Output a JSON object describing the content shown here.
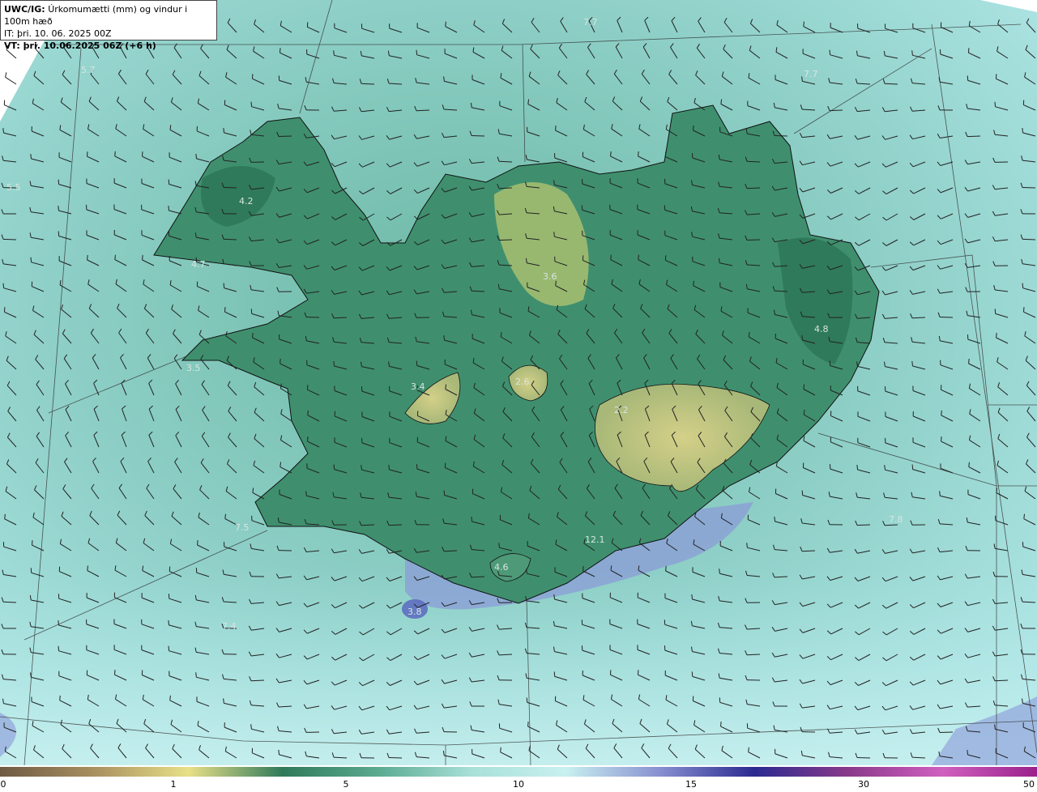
{
  "header": {
    "model": "UWC/IG:",
    "title": "Úrkomumætti (mm) og vindur i 100m hæð",
    "initial_time": "IT: þri. 10. 06. 2025 00Z",
    "valid_time": "VT: þri. 10.06.2025 06Z (+6 h)"
  },
  "map_labels": [
    {
      "id": "l1",
      "text": "5.7"
    },
    {
      "id": "l2",
      "text": "5.5"
    },
    {
      "id": "l3",
      "text": "4.2"
    },
    {
      "id": "l4",
      "text": "4.7"
    },
    {
      "id": "l5",
      "text": "3.5"
    },
    {
      "id": "l6",
      "text": "3.4"
    },
    {
      "id": "l7",
      "text": "2.6"
    },
    {
      "id": "l8",
      "text": "3.6"
    },
    {
      "id": "l9",
      "text": "2.2"
    },
    {
      "id": "l10",
      "text": "4.8"
    },
    {
      "id": "l11",
      "text": "7.7"
    },
    {
      "id": "l12",
      "text": "7.7"
    },
    {
      "id": "l13",
      "text": "7.8"
    },
    {
      "id": "l14",
      "text": "7.5"
    },
    {
      "id": "l15",
      "text": "7.4"
    },
    {
      "id": "l16",
      "text": "4.6"
    },
    {
      "id": "l17",
      "text": "3.8"
    },
    {
      "id": "l18",
      "text": "12.1"
    }
  ],
  "colorbar": {
    "ticks": [
      "0",
      "1",
      "5",
      "10",
      "15",
      "30",
      "50"
    ],
    "colors": [
      "#6e5a44",
      "#a89060",
      "#e8e088",
      "#2f7a5a",
      "#5aaa90",
      "#a8e0d8",
      "#c8f0f0",
      "#8890d0",
      "#2a2a90",
      "#8a3a8a",
      "#d060c0",
      "#9a208a"
    ]
  },
  "palette": {
    "sea": "#8fd0c8",
    "land_low": "#3a8c6a",
    "land_high": "#c8c87a",
    "south_sea": "#a8e4e4",
    "heavy": "#6a78c8"
  }
}
